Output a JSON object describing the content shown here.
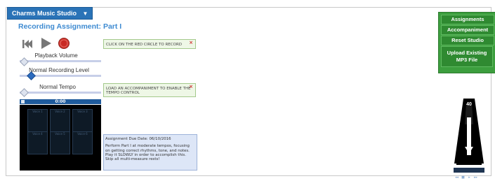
{
  "app": {
    "studio_label": "Charms Music Studio",
    "title": "Recording Assignment: Part I"
  },
  "controls": {
    "playback_volume_label": "Playback Volume",
    "recording_level_label": "Normal Recording Level",
    "tempo_label": "Normal Tempo",
    "time": "0:00"
  },
  "tips": {
    "record_tip": "CLICK ON THE RED CIRCLE TO RECORD",
    "tempo_tip": "LOAD AN ACCOMPANIMENT TO ENABLE THE TEMPO CONTROL",
    "close_glyph": "×"
  },
  "video_tiles": [
    {
      "label": "Voice 1"
    },
    {
      "label": "Voice 2"
    },
    {
      "label": "Voice 3"
    },
    {
      "label": "Voice 4"
    },
    {
      "label": "Voice 5"
    },
    {
      "label": "Voice 6"
    }
  ],
  "assignment": {
    "due": "Assignment Due Date: 06/10/2016",
    "instructions": "Perform Part I at moderate tempos, focusing on getting correct rhythms, tone, and notes. Play it SLOWLY in order to accomplish this. Skip all multi-measure rests!"
  },
  "side_menu": {
    "assignments": "Assignments",
    "accompaniment": "Accompaniment",
    "reset": "Reset Studio",
    "upload": "Upload Existing MP3 File"
  },
  "metronome": {
    "bpm": "40",
    "ctrl_glyphs": [
      "◂◂",
      "■",
      "▸",
      "▸▸"
    ]
  },
  "levels": {
    "playback_volume": 0.0,
    "recording_level": 0.12,
    "tempo": 0.0
  },
  "colors": {
    "accent_blue": "#3d8ad1",
    "record_red": "#d23a32",
    "side_green": "#3c9e3e"
  }
}
